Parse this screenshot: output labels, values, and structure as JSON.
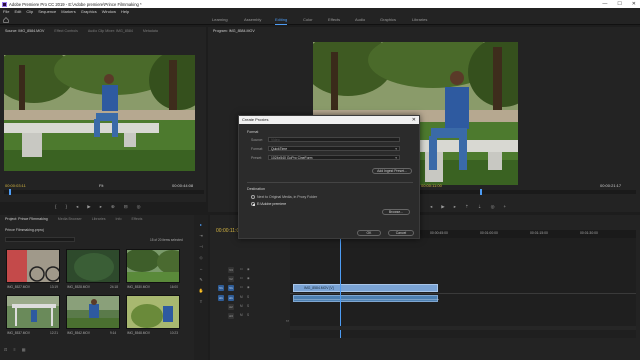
{
  "window": {
    "title": "Adobe Premiere Pro CC 2019 - E:\\Adobe premiere\\Prince Filmmaking *",
    "controls": [
      "—",
      "☐",
      "✕"
    ]
  },
  "menu": [
    "File",
    "Edit",
    "Clip",
    "Sequence",
    "Markers",
    "Graphics",
    "Window",
    "Help"
  ],
  "workspaces": [
    {
      "label": "Learning",
      "active": false
    },
    {
      "label": "Assembly",
      "active": false
    },
    {
      "label": "Editing",
      "active": true
    },
    {
      "label": "Color",
      "active": false
    },
    {
      "label": "Effects",
      "active": false
    },
    {
      "label": "Audio",
      "active": false
    },
    {
      "label": "Graphics",
      "active": false
    },
    {
      "label": "Libraries",
      "active": false
    }
  ],
  "source": {
    "tabs": [
      "Source: IMG_8584.MOV",
      "Effect Controls",
      "Audio Clip Mixer: IMG_8584",
      "Metadata"
    ],
    "timecode": "00:00:03:11",
    "duration": "00:00:44:08",
    "fit": "Fit"
  },
  "program": {
    "tab": "Program: IMG_8584.MOV",
    "timecode": "00:00:11:00",
    "duration": "00:00:21:17",
    "full": "Full"
  },
  "project": {
    "tabs": [
      "Project: Prince Filmmaking",
      "Media Browser",
      "Libraries",
      "Info",
      "Effects"
    ],
    "file": "Prince Filmmaking.prproj",
    "status": "15 of 20 items selected",
    "items": [
      {
        "name": "IMG_8527.MOV",
        "dur": "13:19"
      },
      {
        "name": "IMG_8528.MOV",
        "dur": "24:18"
      },
      {
        "name": "IMG_8530.MOV",
        "dur": "16:00"
      },
      {
        "name": "IMG_8537.MOV",
        "dur": "12:21"
      },
      {
        "name": "IMG_8542.MOV",
        "dur": "9:14"
      },
      {
        "name": "IMG_8548.MOV",
        "dur": "10:23"
      }
    ]
  },
  "timeline": {
    "timecode": "00:00:11:00",
    "ruler": [
      "00:00:45:00",
      "00:01:00:00",
      "00:01:15:00",
      "00:01:30:00"
    ],
    "clip_label": "IMG_8584.MOV [V]",
    "tracks_v": [
      "V3",
      "V2",
      "V1"
    ],
    "tracks_a": [
      "A1",
      "A2",
      "A3"
    ],
    "source_patch": [
      "V1",
      "A1"
    ]
  },
  "dialog": {
    "title": "Create Proxies",
    "close": "✕",
    "format_section": "Format",
    "source_label": "Source:",
    "source_value": "Video",
    "format_label": "Format:",
    "format_value": "QuickTime",
    "preset_label": "Preset:",
    "preset_value": "1024x540 GoPro CineForm",
    "add_ingest": "Add Ingest Preset...",
    "dest_section": "Destination",
    "dest_opt1": "Next to Original Media, in Proxy Folder",
    "dest_opt2": "E:\\Adobe premiere",
    "browse": "Browse...",
    "ok": "OK",
    "cancel": "Cancel"
  },
  "colors": {
    "accent": "#4d9cf4",
    "timecode": "#d4b542",
    "clip_video": "#7aa3d4",
    "clip_audio": "#4d7fb0"
  }
}
